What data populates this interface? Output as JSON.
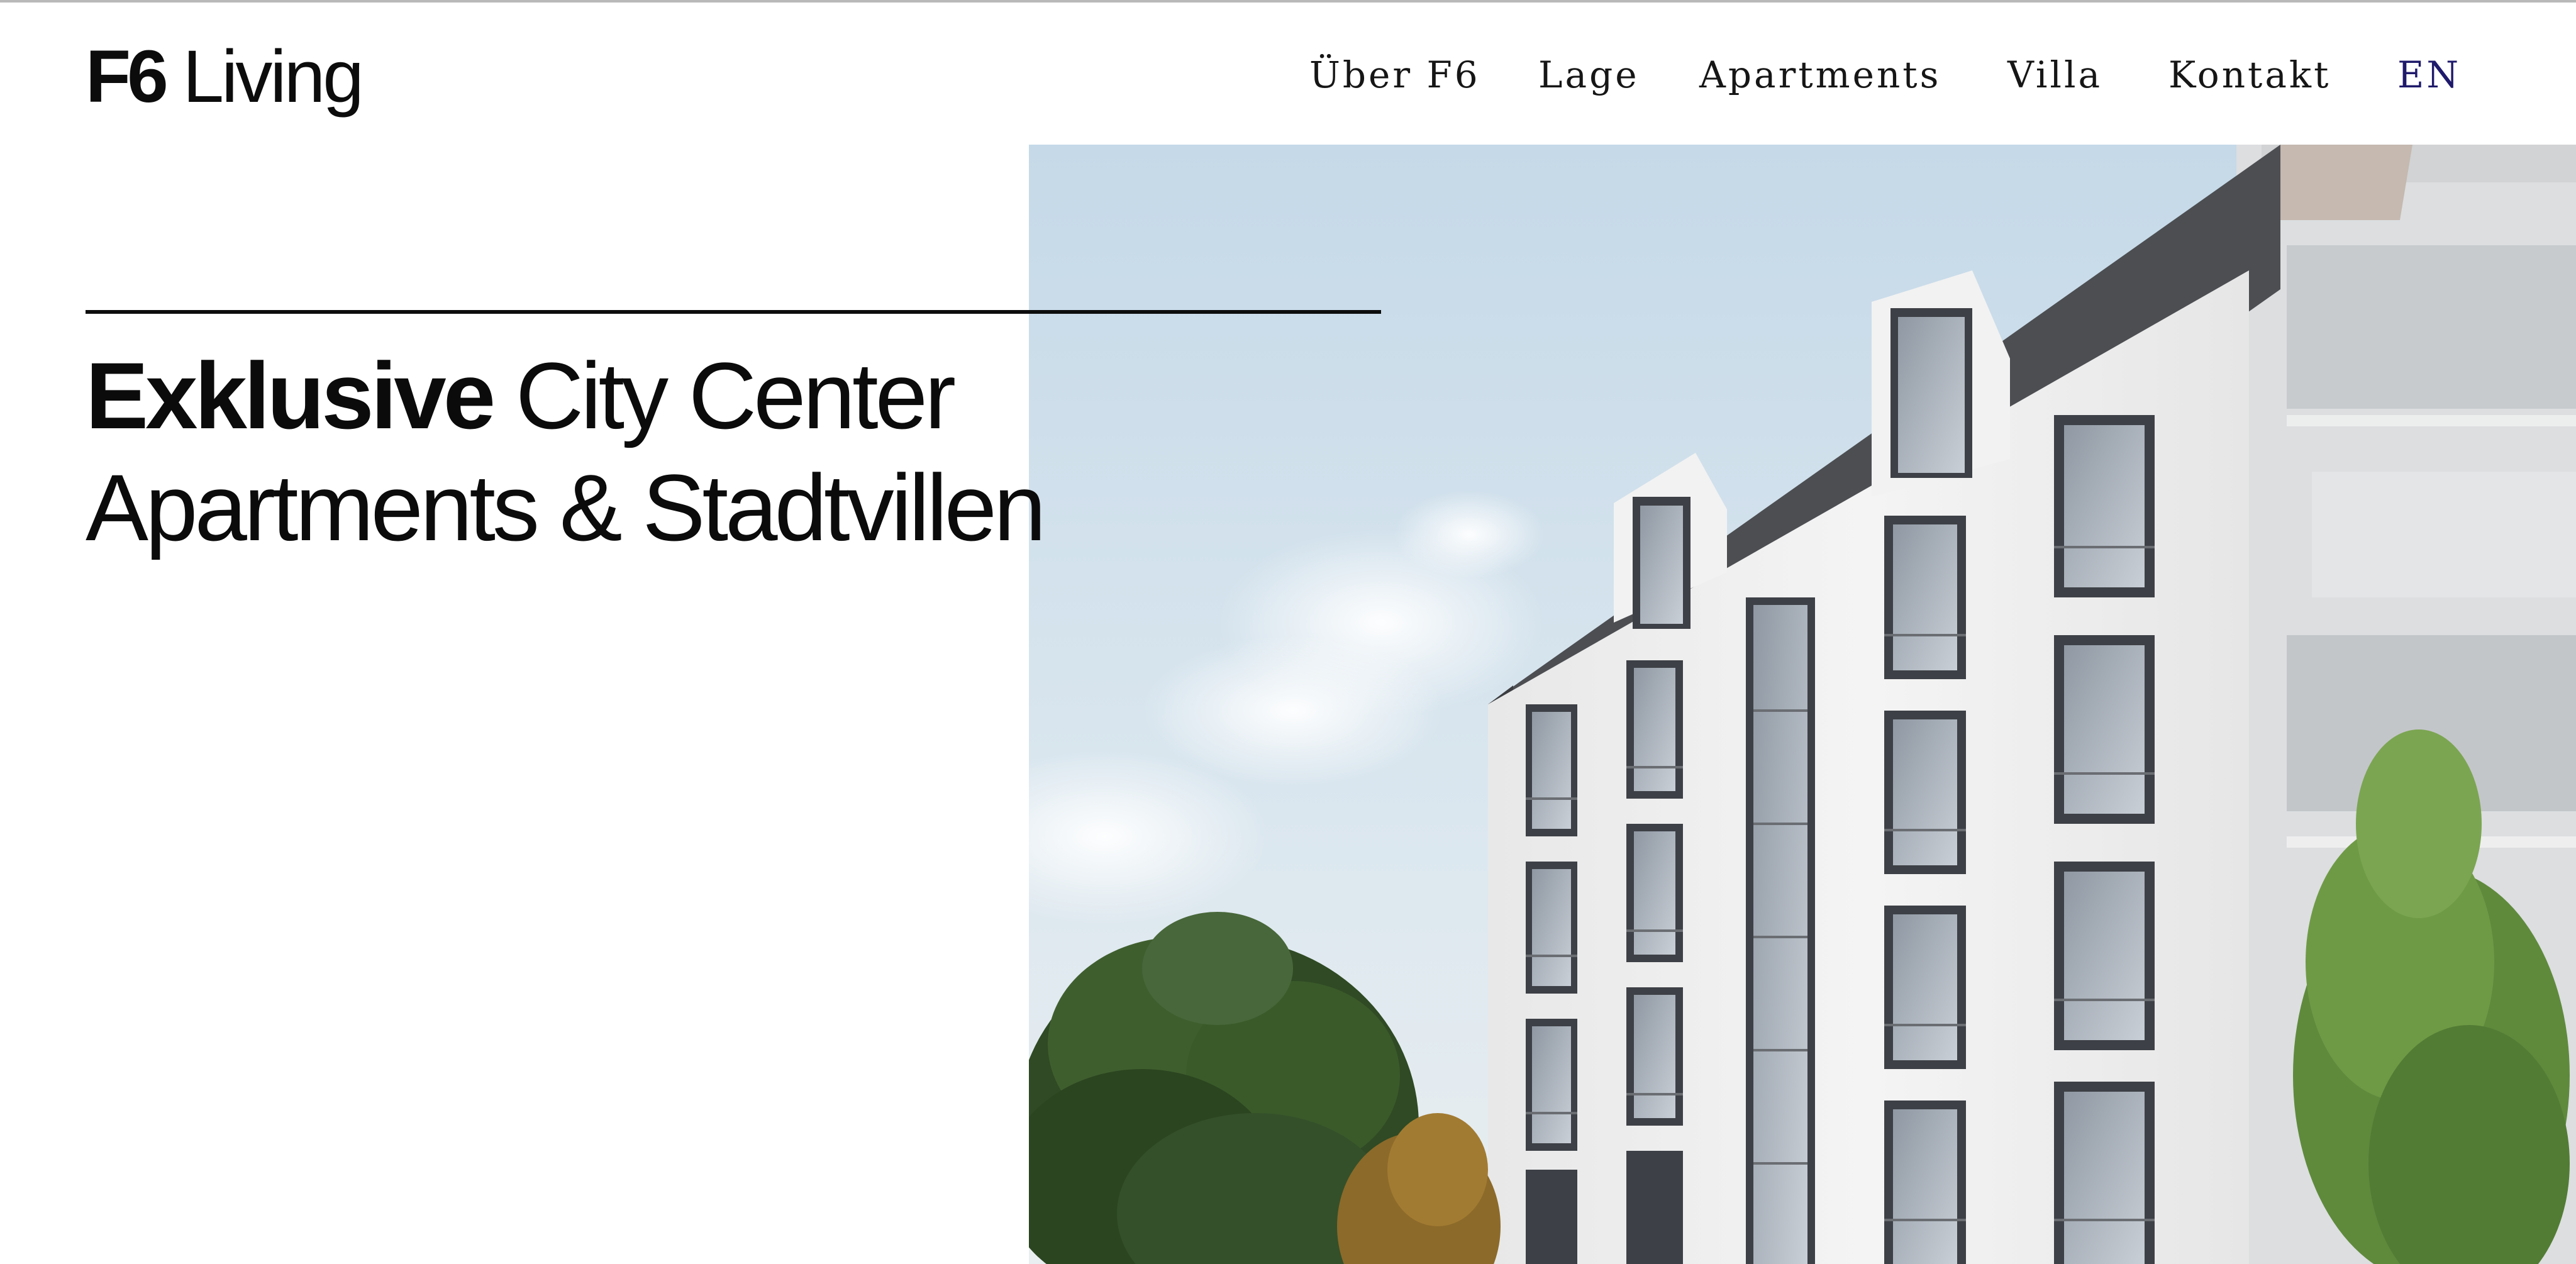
{
  "brand": {
    "logo_bold": "F6",
    "logo_light": "Living"
  },
  "nav": {
    "items": [
      {
        "label": "Über F6"
      },
      {
        "label": "Lage"
      },
      {
        "label": "Apartments"
      },
      {
        "label": "Villa"
      },
      {
        "label": "Kontakt"
      },
      {
        "label": "EN"
      }
    ]
  },
  "hero": {
    "headline_bold": "Exklusive",
    "headline_rest_line1": "City Center",
    "headline_line2": "Apartments & Stadtvillen",
    "image_subject": "architectural rendering of apartment building with trees"
  },
  "colors": {
    "text": "#111111",
    "lang_accent": "#1f1a6b",
    "sky": "#c9dbe9"
  }
}
